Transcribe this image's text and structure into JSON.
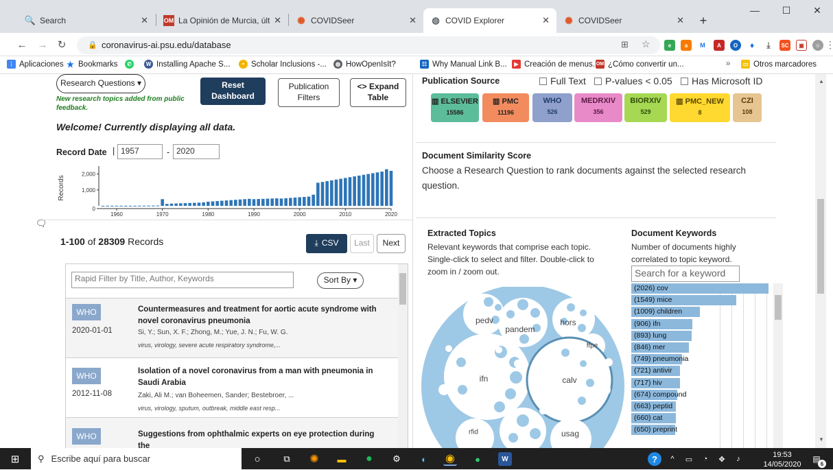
{
  "browser": {
    "tabs": [
      {
        "title": "Search",
        "fav": "search-icon",
        "color": "#4285f4"
      },
      {
        "title": "La Opinión de Murcia, últimas",
        "fav": "om-icon",
        "color": "#c0392b"
      },
      {
        "title": "COVIDSeer",
        "fav": "covidseer-icon",
        "color": "#e0592a"
      },
      {
        "title": "COVID Explorer",
        "fav": "globe-icon",
        "color": "#5f6368"
      },
      {
        "title": "COVIDSeer",
        "fav": "covidseer-icon",
        "color": "#e0592a"
      }
    ],
    "url": "coronavirus-ai.psu.edu/database",
    "bookmarks": [
      {
        "label": "Aplicaciones",
        "color": "#4285f4"
      },
      {
        "label": "Bookmarks",
        "color": "#1a73e8"
      },
      {
        "label": "",
        "color": "#25d366"
      },
      {
        "label": "Installing Apache S...",
        "color": "#3b5998"
      },
      {
        "label": "Scholar Inclusions -...",
        "color": "#f4b400"
      },
      {
        "label": "HowOpenIsIt?",
        "color": "#5f6368"
      },
      {
        "label": "Why Manual Link B...",
        "color": "#1565c0"
      },
      {
        "label": "Creación de menus...",
        "color": "#e53935"
      },
      {
        "label": "¿Cómo convertir un...",
        "color": "#c0392b"
      }
    ],
    "bookmarks_more": "»",
    "other_bookmarks": "Otros marcadores"
  },
  "left": {
    "research_questions": "Research Questions ▾",
    "new_topics_note": "New research topics added from public feedback.",
    "reset": "Reset Dashboard",
    "publication_filters": "Publication Filters",
    "expand_table": "<> Expand Table",
    "welcome": "Welcome! Currently displaying all data.",
    "record_date_label": "Record Date",
    "date_from": "1957",
    "date_to": "2020",
    "hist_ylabel": "Records",
    "hist_yticks": [
      "2,000",
      "1,000",
      "0"
    ],
    "hist_xticks": [
      "1960",
      "1970",
      "1980",
      "1990",
      "2000",
      "2010",
      "2020"
    ],
    "records_range": "1-100",
    "records_of": "of",
    "records_total": "28309",
    "records_word": "Records",
    "csv": "CSV",
    "last": "Last",
    "next": "Next",
    "filter_placeholder": "Rapid Filter by Title, Author, Keywords",
    "sort_by": "Sort By ▾"
  },
  "records": [
    {
      "source": "WHO",
      "date": "2020-01-01",
      "title": "Countermeasures and treatment for aortic acute syndrome with novel coronavirus pneumonia",
      "authors": "Si, Y.; Sun, X. F.; Zhong, M.; Yue, J. N.; Fu, W. G.",
      "keywords": "virus, virology, severe acute respiratory syndrome,..."
    },
    {
      "source": "WHO",
      "date": "2012-11-08",
      "title": "Isolation of a novel coronavirus from a man with pneumonia in Saudi Arabia",
      "authors": "Zaki, Ali M.; van Boheemen, Sander; Bestebroer, ...",
      "keywords": "virus, virology, sputum, outbreak, middle east resp..."
    },
    {
      "source": "WHO",
      "date": "",
      "title": "Suggestions from ophthalmic experts on eye protection during the",
      "authors": "",
      "keywords": ""
    }
  ],
  "right": {
    "pub_source_title": "Publication Source",
    "full_text": "Full Text",
    "pvalues": "P-values < 0.05",
    "microsoft_id": "Has Microsoft ID",
    "sources": [
      {
        "name": "ELSEVIER",
        "count": "15586",
        "color": "#5cbd9a"
      },
      {
        "name": "PMC",
        "count": "11196",
        "color": "#f28c5e"
      },
      {
        "name": "WHO",
        "count": "526",
        "color": "#8fa0cc"
      },
      {
        "name": "MEDRXIV",
        "count": "356",
        "color": "#e98ac8"
      },
      {
        "name": "BIORXIV",
        "count": "529",
        "color": "#a6d854"
      },
      {
        "name": "PMC_NEW",
        "count": "8",
        "color": "#ffd92f"
      },
      {
        "name": "CZI",
        "count": "108",
        "color": "#e6c590"
      }
    ],
    "similarity_title": "Document Similarity Score",
    "similarity_text": "Choose a Research Question to rank documents against the selected research question.",
    "topics_title": "Extracted Topics",
    "topics_text": "Relevant keywords that comprise each topic. Single-click to select and filter. Double-click to zoom in / zoom out.",
    "keywords_title": "Document Keywords",
    "keywords_text": "Number of documents highly correlated to topic keyword.",
    "keyword_placeholder": "Search for a keyword",
    "bubbles": [
      "pedv",
      "pandem",
      "hors",
      "ffpe",
      "ifn",
      "calv",
      "rfid",
      "usag"
    ]
  },
  "keywords": [
    {
      "label": "(2026) cov",
      "value": 2026
    },
    {
      "label": "(1549) mice",
      "value": 1549
    },
    {
      "label": "(1009) children",
      "value": 1009
    },
    {
      "label": "(906) ifn",
      "value": 906
    },
    {
      "label": "(893) lung",
      "value": 893
    },
    {
      "label": "(846) mer",
      "value": 846
    },
    {
      "label": "(749) pneumonia",
      "value": 749
    },
    {
      "label": "(721) antivir",
      "value": 721
    },
    {
      "label": "(717) hiv",
      "value": 717
    },
    {
      "label": "(674) compound",
      "value": 674
    },
    {
      "label": "(663) peptid",
      "value": 663
    },
    {
      "label": "(660) cat",
      "value": 660
    },
    {
      "label": "(650) preprint",
      "value": 650
    }
  ],
  "chart_data": {
    "type": "bar",
    "ylabel": "Records",
    "ylim": [
      0,
      2500
    ],
    "x": [
      1957,
      1958,
      1959,
      1960,
      1961,
      1962,
      1963,
      1964,
      1965,
      1966,
      1967,
      1968,
      1969,
      1970,
      1971,
      1972,
      1973,
      1974,
      1975,
      1976,
      1977,
      1978,
      1979,
      1980,
      1981,
      1982,
      1983,
      1984,
      1985,
      1986,
      1987,
      1988,
      1989,
      1990,
      1991,
      1992,
      1993,
      1994,
      1995,
      1996,
      1997,
      1998,
      1999,
      2000,
      2001,
      2002,
      2003,
      2004,
      2005,
      2006,
      2007,
      2008,
      2009,
      2010,
      2011,
      2012,
      2013,
      2014,
      2015,
      2016,
      2017,
      2018,
      2019,
      2020
    ],
    "values": [
      5,
      5,
      5,
      5,
      5,
      5,
      5,
      5,
      10,
      10,
      15,
      15,
      20,
      420,
      120,
      140,
      150,
      160,
      170,
      180,
      190,
      200,
      220,
      260,
      280,
      300,
      320,
      340,
      360,
      380,
      400,
      420,
      440,
      420,
      430,
      440,
      450,
      460,
      470,
      460,
      480,
      500,
      520,
      540,
      560,
      580,
      700,
      1450,
      1500,
      1550,
      1600,
      1650,
      1700,
      1750,
      1800,
      1850,
      1900,
      1950,
      2000,
      2050,
      2100,
      2150,
      2300,
      2200
    ]
  },
  "taskbar": {
    "search_placeholder": "Escribe aquí para buscar",
    "time": "19:53",
    "date": "14/05/2020",
    "badge_count": "6"
  }
}
